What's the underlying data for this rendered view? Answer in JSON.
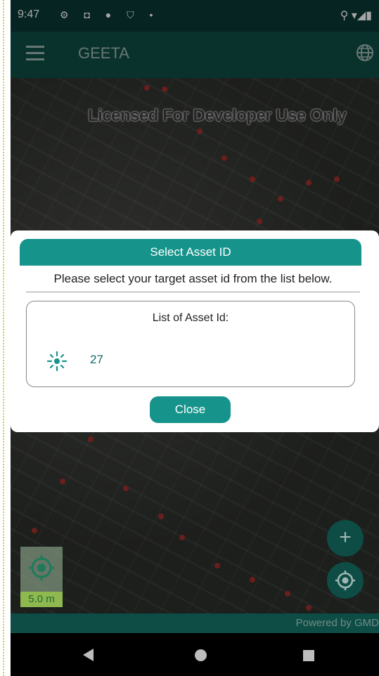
{
  "status_bar": {
    "time": "9:47",
    "left_icons": "⚙ ◘ ● ⛉ •",
    "right_icons": "⚲ ▾◢▮"
  },
  "app_bar": {
    "title": "GEETA"
  },
  "map": {
    "watermark": "Licensed For Developer Use Only",
    "scale_label": "5.0 m",
    "powered_by": "Powered by GMD"
  },
  "dialog": {
    "header": "Select Asset ID",
    "message": "Please select your target asset id from the list below.",
    "list_title": "List of Asset Id:",
    "items": [
      {
        "value": "27",
        "icon": "asset-sun-icon"
      }
    ],
    "close_label": "Close"
  },
  "colors": {
    "teal": "#16948b",
    "appbar": "#0e4d45",
    "statusbar": "#0a3a35"
  }
}
